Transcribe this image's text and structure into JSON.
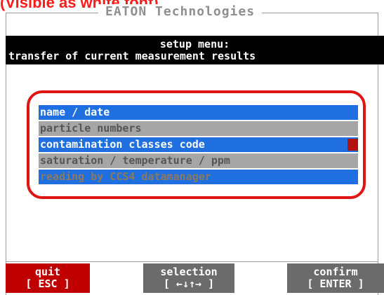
{
  "annotation": "(Visible as white font).",
  "window": {
    "title": "EATON Technologies"
  },
  "header": {
    "line1": "setup menu:",
    "line2": "transfer of current measurement results"
  },
  "menu": {
    "items": [
      {
        "label": "name / date"
      },
      {
        "label": "particle numbers"
      },
      {
        "label": "contamination classes code"
      },
      {
        "label": "saturation / temperature / ppm"
      },
      {
        "label": "reading by CCS4 datamanager"
      }
    ]
  },
  "function_keys": {
    "quit": {
      "label": "quit",
      "key": "[ ESC ]"
    },
    "selection": {
      "label": "selection",
      "key": "[ ←↓↑→ ]"
    },
    "confirm": {
      "label": "confirm",
      "key": "[ ENTER ]"
    }
  },
  "colors": {
    "highlight_row": "#1f6fe0",
    "inactive_row": "#a6a6a6",
    "quit_key": "#c00000",
    "annotation": "#ff1a1a"
  }
}
